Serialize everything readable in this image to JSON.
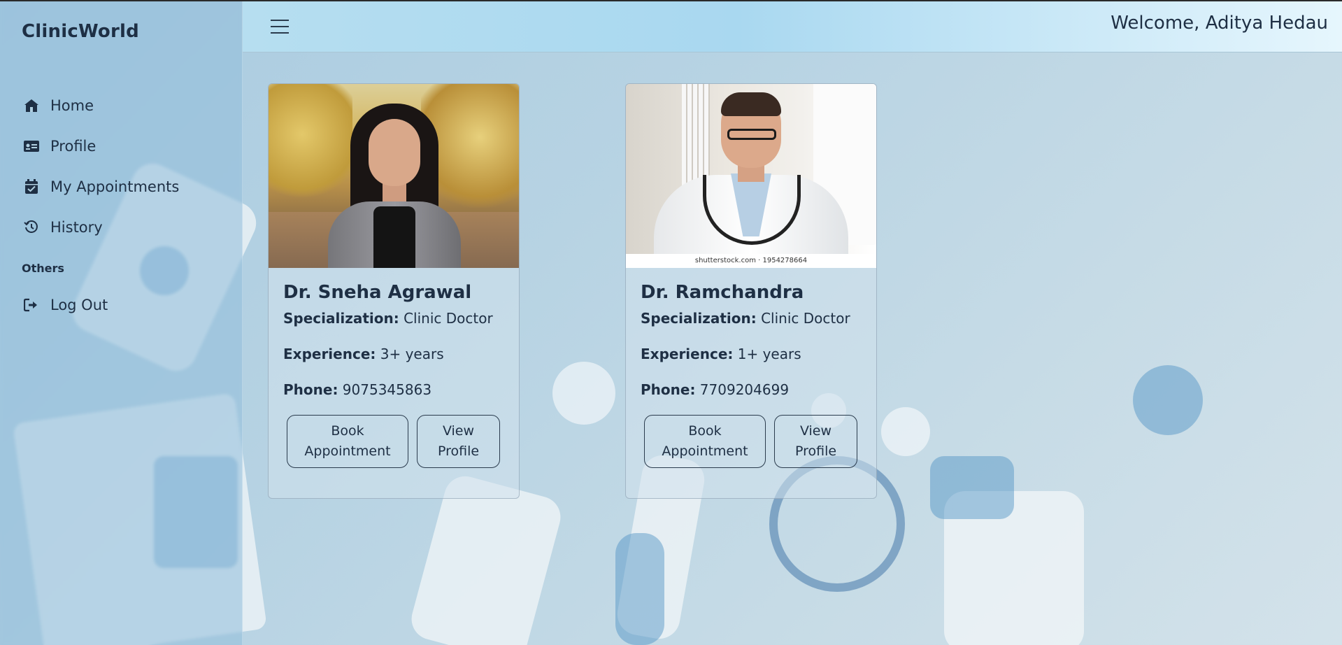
{
  "app": {
    "brand": "ClinicWorld"
  },
  "sidebar": {
    "items": [
      {
        "label": "Home",
        "icon": "home-icon"
      },
      {
        "label": "Profile",
        "icon": "id-card-icon"
      },
      {
        "label": "My Appointments",
        "icon": "calendar-check-icon"
      },
      {
        "label": "History",
        "icon": "history-icon"
      }
    ],
    "section_label": "Others",
    "logout": {
      "label": "Log Out",
      "icon": "logout-icon"
    }
  },
  "header": {
    "menu_icon": "hamburger-icon",
    "welcome": "Welcome, Aditya Hedau"
  },
  "doctors": [
    {
      "name": "Dr. Sneha Agrawal",
      "specialization_label": "Specialization:",
      "specialization": "Clinic Doctor",
      "experience_label": "Experience:",
      "experience": "3+ years",
      "phone_label": "Phone:",
      "phone": "9075345863",
      "book_label_1": "Book",
      "book_label_2": "Appointment",
      "view_label_1": "View",
      "view_label_2": "Profile"
    },
    {
      "name": "Dr. Ramchandra",
      "specialization_label": "Specialization:",
      "specialization": "Clinic Doctor",
      "experience_label": "Experience:",
      "experience": "1+ years",
      "phone_label": "Phone:",
      "phone": "7709204699",
      "book_label_1": "Book",
      "book_label_2": "Appointment",
      "view_label_1": "View",
      "view_label_2": "Profile",
      "photo_caption": "shutterstock.com · 1954278664"
    }
  ],
  "colors": {
    "text": "#1e2f44",
    "topbar_start": "#b6def0",
    "topbar_end": "#e6f6fd",
    "sidebar_bg": "#91bed8"
  }
}
